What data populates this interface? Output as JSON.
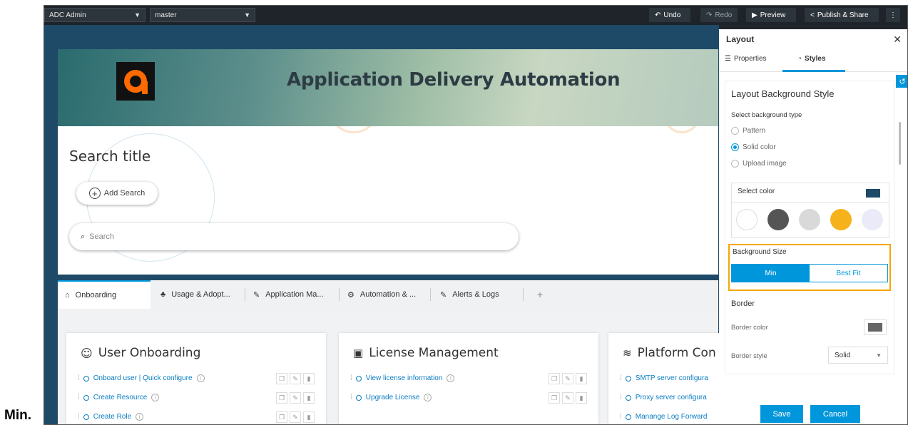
{
  "caption": "Min.",
  "topbar": {
    "app_select": "ADC Admin",
    "branch_select": "master",
    "undo": "Undo",
    "redo": "Redo",
    "preview": "Preview",
    "publish": "Publish & Share",
    "more": "⋮"
  },
  "header": {
    "title": "Application Delivery Automation"
  },
  "search": {
    "title": "Search title",
    "add_search": "Add Search",
    "placeholder": "Search"
  },
  "tabs": [
    {
      "label": "Onboarding",
      "icon": "home-icon"
    },
    {
      "label": "Usage & Adopt...",
      "icon": "people-icon"
    },
    {
      "label": "Application Ma...",
      "icon": "edit-doc-icon"
    },
    {
      "label": "Automation & ...",
      "icon": "gear-db-icon"
    },
    {
      "label": "Alerts & Logs",
      "icon": "edit-doc-icon"
    }
  ],
  "cards": [
    {
      "title": "User Onboarding",
      "icon": "users-icon",
      "rows": [
        "Onboard user | Quick configure",
        "Create Resource",
        "Create Role"
      ]
    },
    {
      "title": "License Management",
      "icon": "certificate-icon",
      "rows": [
        "View license information",
        "Upgrade License"
      ]
    },
    {
      "title": "Platform Con",
      "icon": "layers-icon",
      "rows": [
        "SMTP server configura",
        "Proxy server configura",
        "Manange Log Forward"
      ]
    }
  ],
  "panel": {
    "title": "Layout",
    "tab_properties": "Properties",
    "tab_styles": "Styles",
    "section_title": "Layout Background Style",
    "bg_type_label": "Select background type",
    "bg_types": [
      "Pattern",
      "Solid color",
      "Upload image"
    ],
    "bg_type_selected": "Solid color",
    "select_color": "Select color",
    "selected_color": "#1e4a68",
    "swatches": [
      "#ffffff",
      "#555555",
      "#d9d9d9",
      "#f5b21a",
      "#ebeaf8"
    ],
    "bg_size_label": "Background Size",
    "bg_size_options": [
      "Min",
      "Best Fit"
    ],
    "bg_size_selected": "Min",
    "border_title": "Border",
    "border_color_label": "Border color",
    "border_color": "#666666",
    "border_style_label": "Border style",
    "border_style": "Solid",
    "save": "Save",
    "cancel": "Cancel"
  }
}
